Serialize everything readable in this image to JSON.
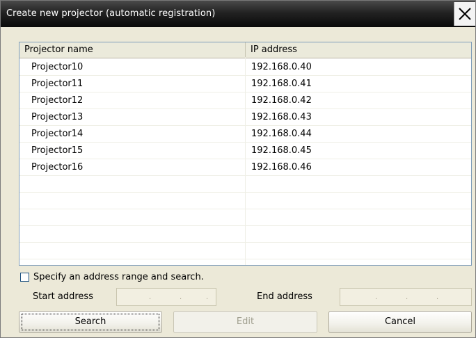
{
  "window": {
    "title": "Create new projector (automatic registration)",
    "close_icon": "close-icon"
  },
  "list": {
    "columns": [
      "Projector name",
      "IP address"
    ],
    "rows": [
      {
        "name": "Projector10",
        "ip": "192.168.0.40"
      },
      {
        "name": "Projector11",
        "ip": "192.168.0.41"
      },
      {
        "name": "Projector12",
        "ip": "192.168.0.42"
      },
      {
        "name": "Projector13",
        "ip": "192.168.0.43"
      },
      {
        "name": "Projector14",
        "ip": "192.168.0.44"
      },
      {
        "name": "Projector15",
        "ip": "192.168.0.45"
      },
      {
        "name": "Projector16",
        "ip": "192.168.0.46"
      }
    ]
  },
  "range": {
    "checkbox_label": "Specify an address range and search.",
    "checked": false,
    "start_label": "Start address",
    "end_label": "End address",
    "start_value": "",
    "end_value": ""
  },
  "buttons": {
    "search": "Search",
    "edit": "Edit",
    "cancel": "Cancel"
  }
}
